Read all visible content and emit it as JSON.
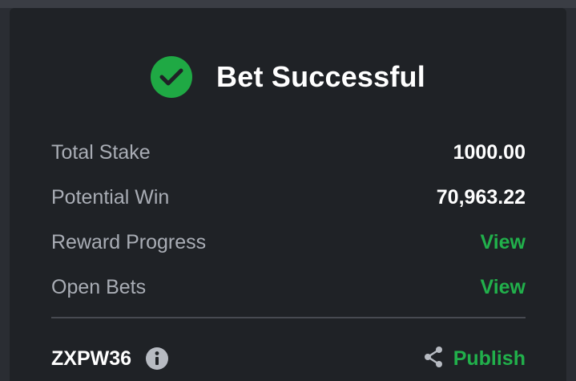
{
  "header": {
    "title": "Bet Successful",
    "icon": "check-circle-icon",
    "success_color": "#1fa944"
  },
  "summary": {
    "rows": [
      {
        "label": "Total Stake",
        "value": "1000.00"
      },
      {
        "label": "Potential Win",
        "value": "70,963.22"
      },
      {
        "label": "Reward Progress",
        "link": "View"
      },
      {
        "label": "Open Bets",
        "link": "View"
      }
    ]
  },
  "footer": {
    "booking_code": "ZXPW36",
    "info_icon": "info-icon",
    "share_icon": "share-icon",
    "publish_label": "Publish"
  },
  "colors": {
    "background": "#1f2226",
    "accent": "#21b04b",
    "label": "#a9adb5",
    "value": "#ffffff"
  }
}
